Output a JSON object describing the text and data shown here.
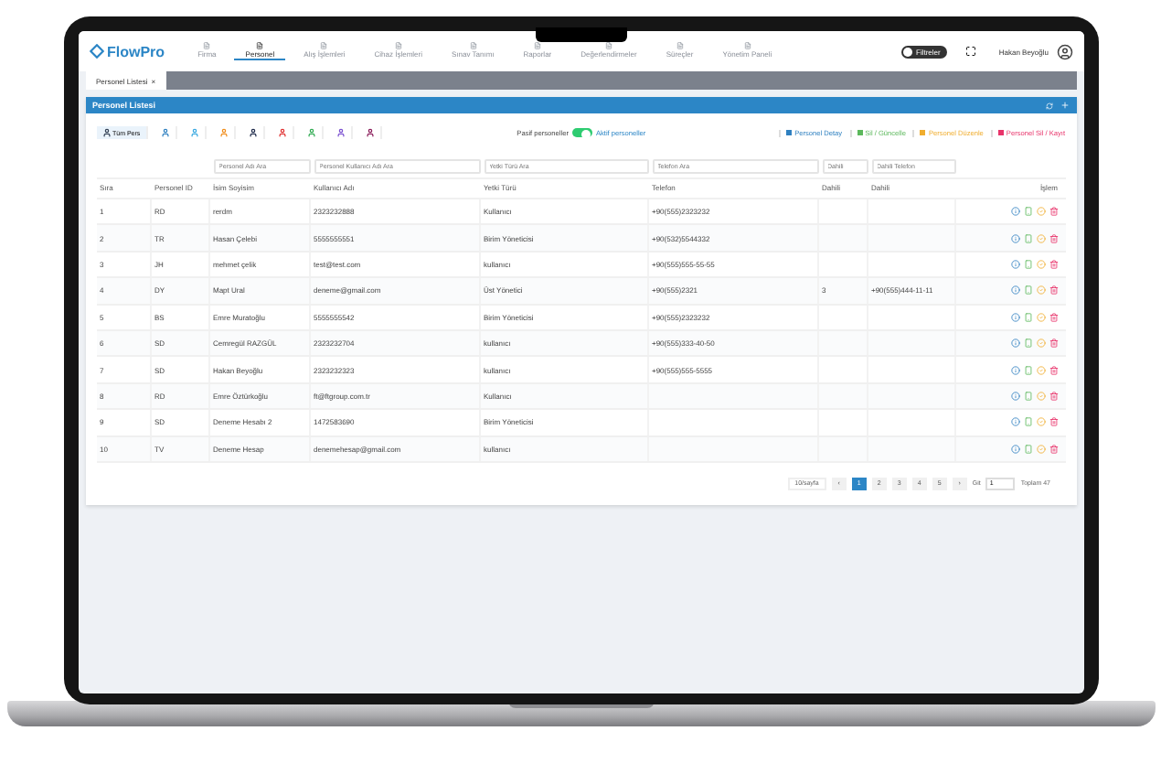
{
  "brand": "FlowPro",
  "nav": [
    {
      "label": "Firma",
      "selected": false
    },
    {
      "label": "Personel",
      "selected": true
    },
    {
      "label": "Alış İşlemleri",
      "selected": false
    },
    {
      "label": "Cihaz İşlemleri",
      "selected": false
    },
    {
      "label": "Sınav Tanımı",
      "selected": false
    },
    {
      "label": "Raporlar",
      "selected": false
    },
    {
      "label": "Değerlendirmeler",
      "selected": false
    },
    {
      "label": "Süreçler",
      "selected": false
    },
    {
      "label": "Yönetim Paneli",
      "selected": false
    }
  ],
  "filter_toggle": {
    "label": "Filtreler",
    "on": false
  },
  "user": "Hakan Beyoğlu",
  "page_tab": {
    "label": "Personel Listesi",
    "close": "×"
  },
  "card_title": "Personel Listesi",
  "toolbar": [
    {
      "label": "Tüm Pers",
      "color": "#334155",
      "selected": true
    },
    {
      "color": "#2f80c0",
      "selected": false
    },
    {
      "color": "#38a8e0",
      "selected": false
    },
    {
      "color": "#f08c1a",
      "selected": false
    },
    {
      "color": "#1e2a4a",
      "selected": false
    },
    {
      "color": "#e03030",
      "selected": false
    },
    {
      "color": "#2eaa50",
      "selected": false
    },
    {
      "color": "#7a4fd0",
      "selected": false
    },
    {
      "color": "#8a1c5a",
      "selected": false
    }
  ],
  "status_switch": {
    "off_label": "Pasif personeller",
    "on_label": "Aktif personeller",
    "on": true
  },
  "legend": [
    {
      "label": "Personel Detay",
      "color": "#2f80c0"
    },
    {
      "label": "Sil / Güncelle",
      "color": "#5cb85c"
    },
    {
      "label": "Personel Düzenle",
      "color": "#f0ad2e"
    },
    {
      "label": "Personel Sil / Kayıt",
      "color": "#e8336a"
    }
  ],
  "filters": [
    {
      "placeholder": "Personel Adı Ara"
    },
    {
      "placeholder": "Personel Kullanıcı Adı Ara"
    },
    {
      "placeholder": "Yetki Türü Ara"
    },
    {
      "placeholder": "Telefon Ara"
    },
    {
      "placeholder": "Dahili"
    },
    {
      "placeholder": "Dahili Telefon"
    }
  ],
  "columns": [
    "Sıra",
    "Personel ID",
    "İsim Soyisim",
    "Kullanıcı Adı",
    "Yetki Türü",
    "Telefon",
    "Dahili",
    "Dahili",
    "İşlem"
  ],
  "rows": [
    [
      "1",
      "RD",
      "rerdm",
      "2323232888",
      "Kullanıcı",
      "+90(555)2323232",
      "",
      ""
    ],
    [
      "2",
      "TR",
      "Hasan Çelebi",
      "5555555551",
      "Birim Yöneticisi",
      "+90(532)5544332",
      "",
      ""
    ],
    [
      "3",
      "JH",
      "mehmet çelik",
      "test@test.com",
      "kullanıcı",
      "+90(555)555-55-55",
      "",
      ""
    ],
    [
      "4",
      "DY",
      "Mapt Ural",
      "deneme@gmail.com",
      "Üst Yönetici",
      "+90(555)2321",
      "3",
      "+90(555)444-11-11"
    ],
    [
      "5",
      "BS",
      "Emre Muratoğlu",
      "5555555542",
      "Birim Yöneticisi",
      "+90(555)2323232",
      "",
      ""
    ],
    [
      "6",
      "SD",
      "Cemregül RAZGÜL",
      "2323232704",
      "kullanıcı",
      "+90(555)333-40-50",
      "",
      ""
    ],
    [
      "7",
      "SD",
      "Hakan Beyoğlu",
      "2323232323",
      "kullanıcı",
      "+90(555)555-5555",
      "",
      ""
    ],
    [
      "8",
      "RD",
      "Emre Öztürkoğlu",
      "ft@ftgroup.com.tr",
      "Kullanıcı",
      "",
      "",
      ""
    ],
    [
      "9",
      "SD",
      "Deneme Hesabı 2",
      "1472583690",
      "Birim Yöneticisi",
      "",
      "",
      ""
    ],
    [
      "10",
      "TV",
      "Deneme Hesap",
      "denemehesap@gmail.com",
      "kullanıcı",
      "",
      "",
      ""
    ]
  ],
  "pagination": {
    "page_size": "10/sayfa",
    "prev": "‹",
    "next": "›",
    "pages": [
      {
        "label": "1",
        "selected": true
      },
      {
        "label": "2",
        "selected": false
      },
      {
        "label": "3",
        "selected": false
      },
      {
        "label": "4",
        "selected": false
      },
      {
        "label": "5",
        "selected": false
      }
    ],
    "goto_label": "Git",
    "goto_value": "1",
    "total": "Toplam 47"
  }
}
